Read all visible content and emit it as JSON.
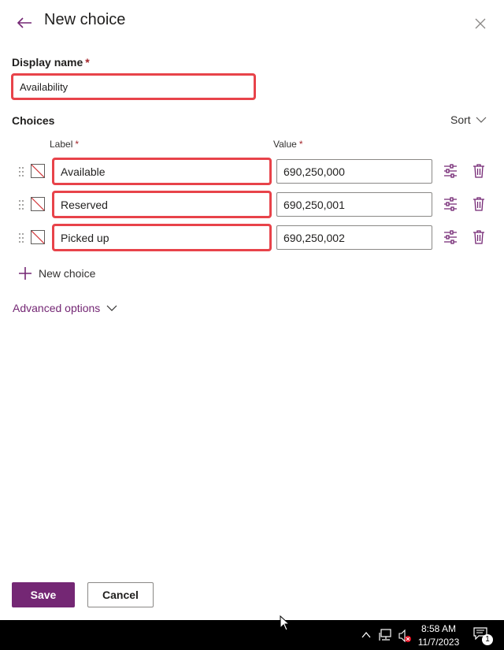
{
  "panel": {
    "title": "New choice",
    "display_name_label": "Display name",
    "display_name_value": "Availability",
    "required_marker": "*",
    "choices_label": "Choices",
    "sort_label": "Sort",
    "label_col": "Label",
    "value_col": "Value",
    "choices": [
      {
        "label": "Available",
        "value": "690,250,000"
      },
      {
        "label": "Reserved",
        "value": "690,250,001"
      },
      {
        "label": "Picked up",
        "value": "690,250,002"
      }
    ],
    "add_choice_label": "New choice",
    "advanced_options_label": "Advanced options",
    "save_label": "Save",
    "cancel_label": "Cancel",
    "accent_color": "#742774"
  },
  "taskbar": {
    "time": "8:58 AM",
    "date": "11/7/2023",
    "notification_count": "1"
  }
}
